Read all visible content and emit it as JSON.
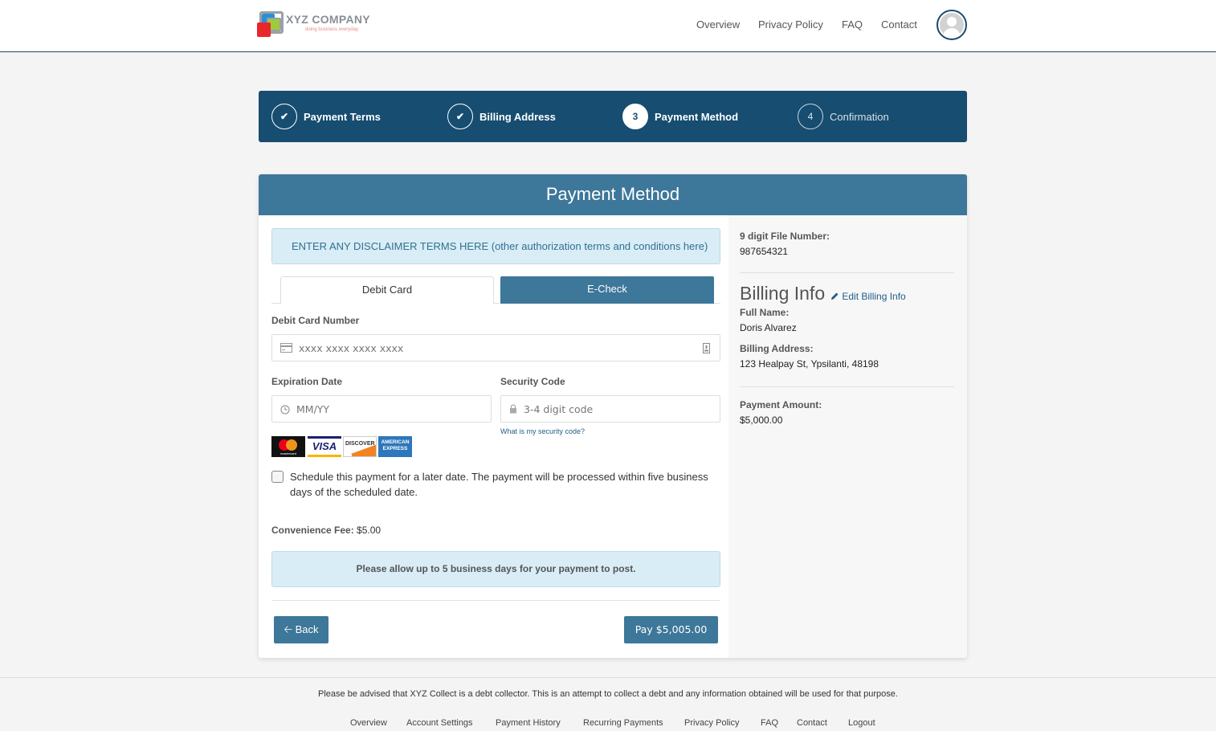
{
  "header": {
    "brand": "XYZ COMPANY",
    "tagline": "doing business everyday",
    "nav": [
      "Overview",
      "Privacy Policy",
      "FAQ",
      "Contact"
    ],
    "avatar_icon": "user-avatar-icon"
  },
  "stepper": {
    "steps": [
      {
        "label": "Payment Terms",
        "status": "complete",
        "marker": "✔"
      },
      {
        "label": "Billing Address",
        "status": "complete",
        "marker": "✔"
      },
      {
        "label": "Payment Method",
        "status": "active",
        "marker": "3"
      },
      {
        "label": "Confirmation",
        "status": "pending",
        "marker": "4"
      }
    ]
  },
  "card": {
    "title": "Payment Method",
    "disclaimer": "ENTER ANY DISCLAIMER TERMS HERE (other authorization terms and conditions here)",
    "tabs": [
      {
        "label": "Debit Card",
        "active": true
      },
      {
        "label": "E-Check",
        "active": false
      }
    ],
    "form": {
      "card_number_label": "Debit Card Number",
      "card_number_placeholder": "xxxx xxxx xxxx xxxx",
      "expiration_label": "Expiration Date",
      "expiration_placeholder": "MM/YY",
      "security_label": "Security Code",
      "security_placeholder": "3-4 digit code",
      "security_help_link": "What is my security code?",
      "accepted_cards": [
        "mastercard",
        "VISA",
        "DISCOVER",
        "AMERICAN EXPRESS"
      ],
      "schedule_checkbox_label": "Schedule this payment for a later date. The payment will be processed within five business days of the scheduled date.",
      "schedule_checked": false,
      "convenience_fee_label": "Convenience Fee:",
      "convenience_fee_value": "$5.00",
      "posting_notice": "Please allow up to 5 business days for your payment to post."
    },
    "buttons": {
      "back": "Back",
      "pay": "Pay $5,005.00"
    }
  },
  "summary": {
    "file_number_label": "9 digit File Number:",
    "file_number": "987654321",
    "billing_title": "Billing Info",
    "edit_link": "Edit Billing Info",
    "full_name_label": "Full Name:",
    "full_name": "Doris Alvarez",
    "billing_address_label": "Billing Address:",
    "billing_address": "123 Healpay St, Ypsilanti, 48198",
    "payment_amount_label": "Payment Amount:",
    "payment_amount": "$5,000.00"
  },
  "footer": {
    "notice": "Please be advised that XYZ Collect is a debt collector. This is an attempt to collect a debt and any information obtained will be used for that purpose.",
    "links": [
      "Overview",
      "Account Settings",
      "Payment History",
      "Recurring Payments",
      "Privacy Policy",
      "FAQ",
      "Contact",
      "Logout"
    ]
  },
  "colors": {
    "primary": "#164d70",
    "accent": "#3d7799",
    "info_bg": "#d9edf7",
    "info_text": "#31708f"
  }
}
